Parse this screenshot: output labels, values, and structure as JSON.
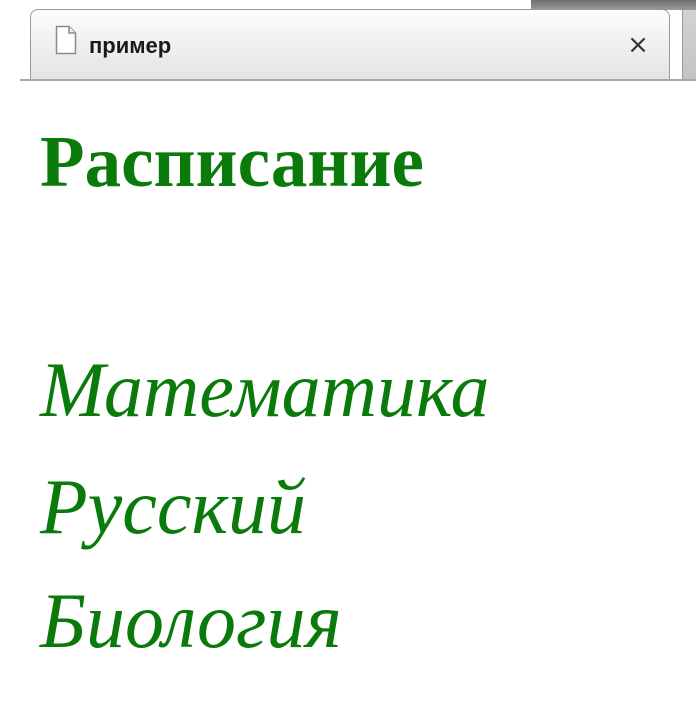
{
  "browser": {
    "tab": {
      "title": "пример",
      "close_label": "×",
      "icon": "page-icon"
    }
  },
  "page": {
    "heading": "Расписание",
    "subjects": [
      "Математика",
      "Русский",
      "Биология"
    ]
  },
  "colors": {
    "text_green": "#0a7a0a"
  }
}
